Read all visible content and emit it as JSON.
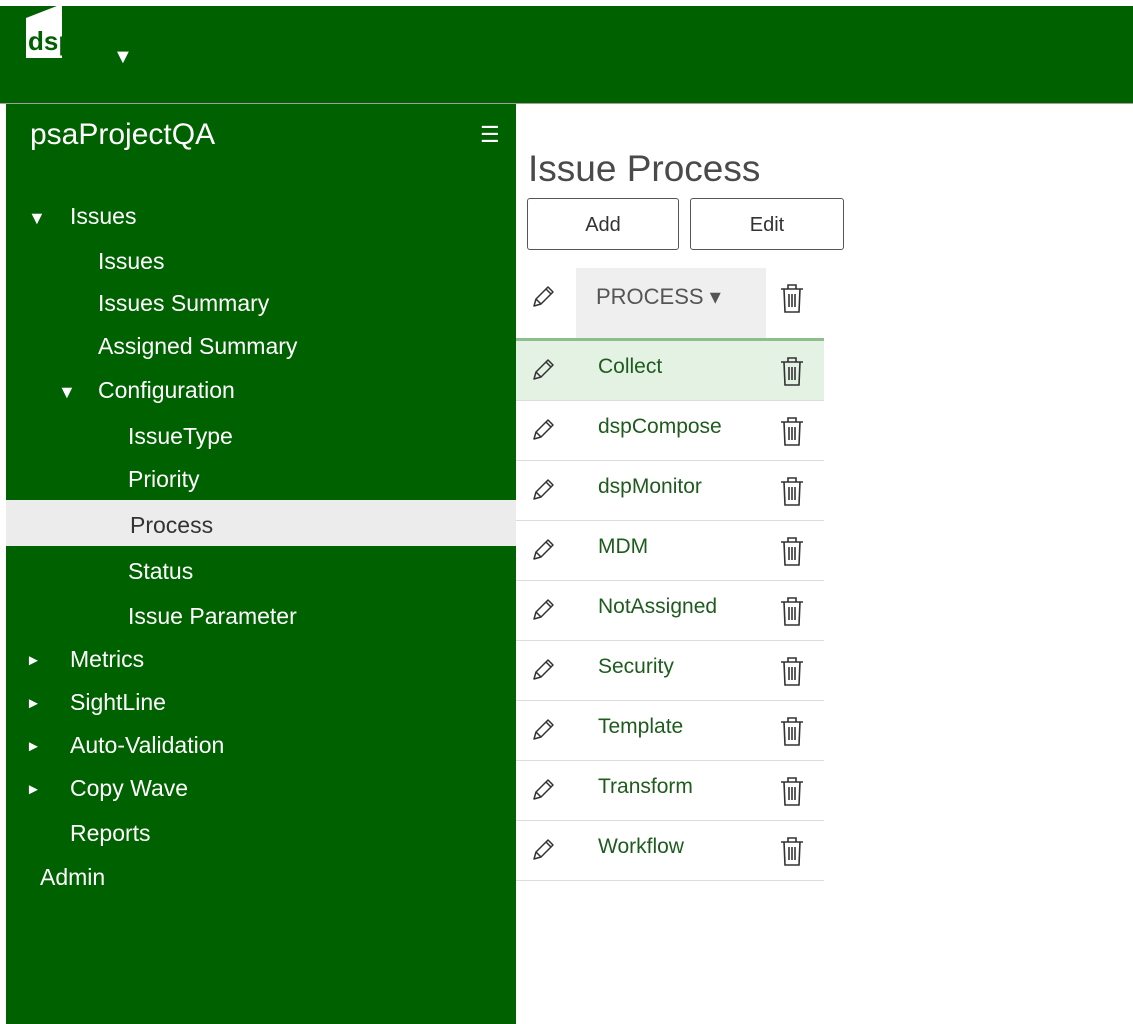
{
  "header": {
    "logo_text": "dsp",
    "menu_arrow": "▼"
  },
  "sidebar": {
    "project": "psaProjectQA",
    "menu_icon": "☰",
    "items": [
      {
        "label": "Issues",
        "arrow": "▼"
      },
      {
        "label": "Issues"
      },
      {
        "label": "Issues Summary"
      },
      {
        "label": "Assigned Summary"
      },
      {
        "label": "Configuration",
        "arrow": "▼"
      },
      {
        "label": "IssueType"
      },
      {
        "label": "Priority"
      },
      {
        "label": "Process",
        "selected": true
      },
      {
        "label": "Status"
      },
      {
        "label": "Issue Parameter"
      },
      {
        "label": "Metrics",
        "arrow": "►"
      },
      {
        "label": "SightLine",
        "arrow": "►"
      },
      {
        "label": "Auto-Validation",
        "arrow": "►"
      },
      {
        "label": "Copy Wave",
        "arrow": "►"
      },
      {
        "label": "Reports"
      },
      {
        "label": "Admin"
      }
    ]
  },
  "main": {
    "title": "Issue Process",
    "buttons": {
      "add": "Add",
      "edit": "Edit"
    },
    "column_header": "PROCESS ▾",
    "rows": [
      "Collect",
      "dspCompose",
      "dspMonitor",
      "MDM",
      "NotAssigned",
      "Security",
      "Template",
      "Transform",
      "Workflow"
    ],
    "selected_row": 0
  },
  "colors": {
    "brand_green": "#006100",
    "selected_row": "#e3f2e3",
    "selected_nav": "#ececec"
  }
}
